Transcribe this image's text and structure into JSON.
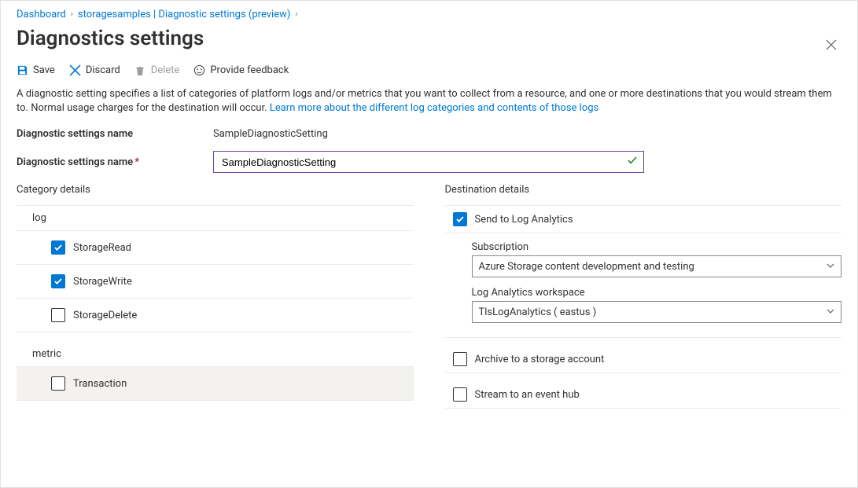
{
  "breadcrumb": {
    "items": [
      {
        "label": "Dashboard"
      },
      {
        "label": "storagesamples | Diagnostic settings (preview)"
      }
    ]
  },
  "page_title": "Diagnostics settings",
  "toolbar": {
    "save": "Save",
    "discard": "Discard",
    "delete": "Delete",
    "feedback": "Provide feedback"
  },
  "description": {
    "text": "A diagnostic setting specifies a list of categories of platform logs and/or metrics that you want to collect from a resource, and one or more destinations that you would stream them to. Normal usage charges for the destination will occur. ",
    "link": "Learn more about the different log categories and contents of those logs"
  },
  "settings_name_label": "Diagnostic settings name",
  "settings_name_value": "SampleDiagnosticSetting",
  "settings_name_input_label": "Diagnostic settings name",
  "settings_name_input_value": "SampleDiagnosticSetting",
  "category_details_title": "Category details",
  "log_section": "log",
  "log_items": [
    {
      "label": "StorageRead",
      "checked": true
    },
    {
      "label": "StorageWrite",
      "checked": true
    },
    {
      "label": "StorageDelete",
      "checked": false
    }
  ],
  "metric_section": "metric",
  "metric_items": [
    {
      "label": "Transaction",
      "checked": false
    }
  ],
  "destination_details_title": "Destination details",
  "dest": {
    "log_analytics": {
      "label": "Send to Log Analytics",
      "checked": true
    },
    "subscription_label": "Subscription",
    "subscription_value": "Azure Storage content development and testing",
    "workspace_label": "Log Analytics workspace",
    "workspace_value": "TlsLogAnalytics ( eastus )",
    "storage": {
      "label": "Archive to a storage account",
      "checked": false
    },
    "eventhub": {
      "label": "Stream to an event hub",
      "checked": false
    }
  }
}
